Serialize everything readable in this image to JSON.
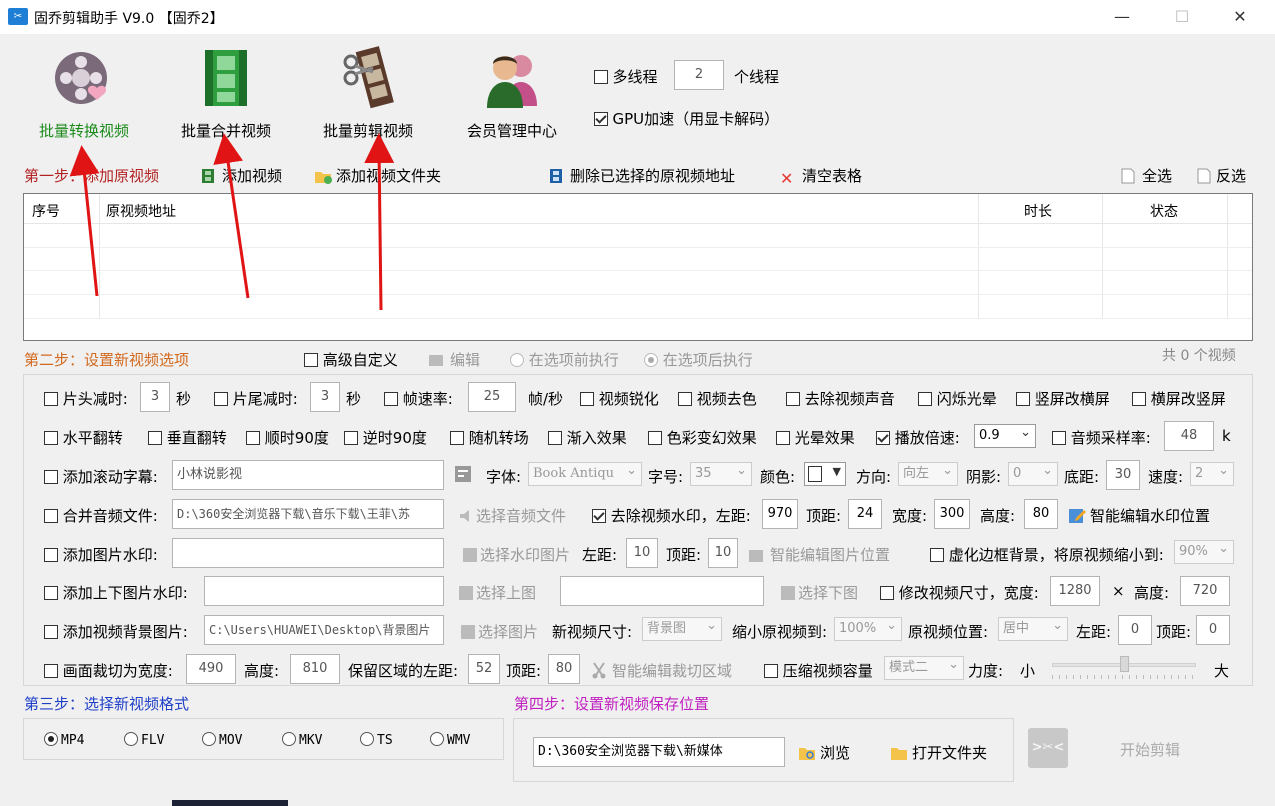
{
  "window": {
    "title": "固乔剪辑助手 V9.0 【固乔2】",
    "app_icon": "video-scissors-icon"
  },
  "toolbar": {
    "tools": [
      {
        "label": "批量转换视频",
        "color": "#1a8a1a"
      },
      {
        "label": "批量合并视频",
        "color": "#000000"
      },
      {
        "label": "批量剪辑视频",
        "color": "#000000"
      },
      {
        "label": "会员管理中心",
        "color": "#000000"
      }
    ],
    "multithread_label": "多线程",
    "multithread_value": "2",
    "thread_unit": "个线程",
    "gpu_label": "GPU加速（用显卡解码）"
  },
  "step1": {
    "title": "第一步：添加原视频",
    "add_video": "添加视频",
    "add_folder": "添加视频文件夹",
    "delete_selected": "删除已选择的原视频地址",
    "clear_table": "清空表格",
    "select_all": "全选",
    "invert": "反选",
    "columns": [
      "序号",
      "原视频地址",
      "时长",
      "状态"
    ]
  },
  "step2": {
    "title": "第二步：设置新视频选项",
    "advanced": "高级自定义",
    "edit": "编辑",
    "before": "在选项前执行",
    "after": "在选项后执行",
    "count": "共 0 个视频",
    "row1": {
      "head_cut": "片头减时:",
      "head_val": "3",
      "sec1": "秒",
      "tail_cut": "片尾减时:",
      "tail_val": "3",
      "sec2": "秒",
      "fps": "帧速率:",
      "fps_val": "25",
      "fps_unit": "帧/秒",
      "sharpen": "视频锐化",
      "decolor": "视频去色",
      "mute": "去除视频声音",
      "flash": "闪烁光晕",
      "v2h": "竖屏改横屏",
      "h2v": "横屏改竖屏"
    },
    "row2": {
      "hflip": "水平翻转",
      "vflip": "垂直翻转",
      "cw90": "顺时90度",
      "ccw90": "逆时90度",
      "random": "随机转场",
      "fadein": "渐入效果",
      "colorshift": "色彩变幻效果",
      "halo": "光晕效果",
      "speed": "播放倍速:",
      "speed_val": "0.9",
      "samplerate": "音频采样率:",
      "samplerate_val": "48",
      "samplerate_unit": "k"
    },
    "row3": {
      "subtitle": "添加滚动字幕:",
      "subtitle_val": "小林说影视",
      "font": "字体:",
      "font_val": "Book Antiqu",
      "size": "字号:",
      "size_val": "35",
      "color": "颜色:",
      "direction": "方向:",
      "direction_val": "向左",
      "shadow": "阴影:",
      "shadow_val": "0",
      "bottom": "底距:",
      "bottom_val": "30",
      "rate": "速度:",
      "rate_val": "2"
    },
    "row4": {
      "merge_audio": "合并音频文件:",
      "merge_audio_val": "D:\\360安全浏览器下载\\音乐下载\\王菲\\苏",
      "choose_audio": "选择音频文件",
      "remove_wm": "去除视频水印，左距:",
      "left_val": "970",
      "top": "顶距:",
      "top_val": "24",
      "width": "宽度:",
      "width_val": "300",
      "height": "高度:",
      "height_val": "80",
      "smart_wm": "智能编辑水印位置"
    },
    "row5": {
      "img_wm": "添加图片水印:",
      "img_wm_val": "",
      "choose_wm": "选择水印图片",
      "left": "左距:",
      "left_val": "10",
      "top": "顶距:",
      "top_val": "10",
      "smart_img": "智能编辑图片位置",
      "blur": "虚化边框背景，将原视频缩小到:",
      "blur_val": "90%"
    },
    "row6": {
      "updown_wm": "添加上下图片水印:",
      "up_val": "",
      "choose_up": "选择上图",
      "down_val": "",
      "choose_down": "选择下图",
      "resize": "修改视频尺寸，宽度:",
      "resize_w": "1280",
      "times": "×",
      "height": "高度:",
      "resize_h": "720"
    },
    "row7": {
      "bg_img": "添加视频背景图片:",
      "bg_val": "C:\\Users\\HUAWEI\\Desktop\\背景图片",
      "choose_img": "选择图片",
      "new_size": "新视频尺寸:",
      "new_size_val": "背景图",
      "shrink": "缩小原视频到:",
      "shrink_val": "100%",
      "pos": "原视频位置:",
      "pos_val": "居中",
      "left": "左距:",
      "left_val": "0",
      "top": "顶距:",
      "top_val": "0"
    },
    "row8": {
      "crop": "画面裁切为宽度:",
      "crop_w": "490",
      "height": "高度:",
      "crop_h": "810",
      "keep_left": "保留区域的左距:",
      "keep_left_val": "52",
      "top": "顶距:",
      "top_val": "80",
      "smart_crop": "智能编辑裁切区域",
      "compress": "压缩视频容量",
      "mode_val": "模式二",
      "force": "力度:",
      "small": "小",
      "large": "大",
      "force_level": 0.5
    }
  },
  "step3": {
    "title": "第三步：选择新视频格式",
    "formats": [
      "MP4",
      "FLV",
      "MOV",
      "MKV",
      "TS",
      "WMV"
    ],
    "selected": "MP4"
  },
  "step4": {
    "title": "第四步：设置新视频保存位置",
    "path": "D:\\360安全浏览器下载\\新媒体",
    "browse": "浏览",
    "open_folder": "打开文件夹",
    "start": "开始剪辑"
  },
  "colors": {
    "step1": "#b22222",
    "step2": "#d2691e",
    "step3": "#1f3fc8",
    "step4": "#c020c0",
    "arrow": "#e01414"
  }
}
